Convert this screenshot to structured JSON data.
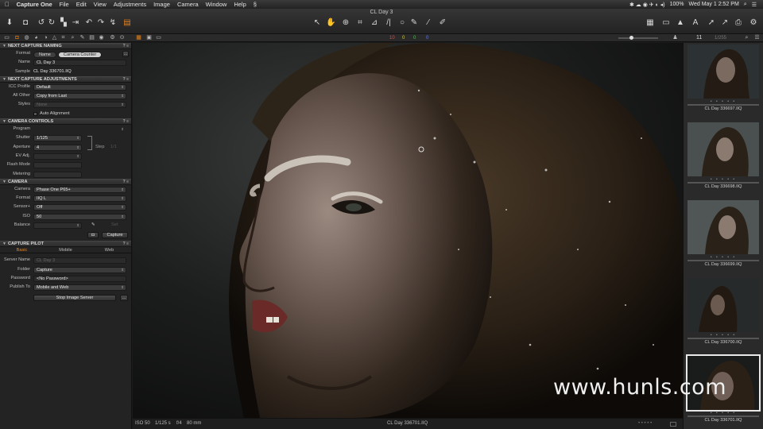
{
  "menubar": {
    "apple_icon": "apple-icon",
    "app": "Capture One",
    "items": [
      "File",
      "Edit",
      "View",
      "Adjustments",
      "Image",
      "Camera",
      "Window",
      "Help"
    ],
    "battery": "100%",
    "clock": "Wed May 1  2:52 PM"
  },
  "window": {
    "title": "CL Day 3"
  },
  "tool_numbers": {
    "a": "10",
    "b": "0",
    "c": "0",
    "d": "0"
  },
  "browser_header": {
    "count": "11",
    "index": "1/255"
  },
  "next_capture_naming": {
    "header": "NEXT CAPTURE NAMING",
    "format_label": "Format",
    "format_options": [
      "Name",
      "Camera Counter"
    ],
    "name_label": "Name",
    "name_value": "CL Day 3",
    "sample_label": "Sample",
    "sample_value": "CL Day 336701.IIQ"
  },
  "next_capture_adjustments": {
    "header": "NEXT CAPTURE ADJUSTMENTS",
    "icc_label": "ICC Profile",
    "icc_value": "Default",
    "other_label": "All Other",
    "other_value": "Copy from Last",
    "styles_label": "Styles",
    "styles_value": "None",
    "auto_alignment": "Auto Alignment"
  },
  "camera_controls": {
    "header": "CAMERA CONTROLS",
    "program_label": "Program",
    "shutter_label": "Shutter",
    "shutter_value": "1/125",
    "aperture_label": "Aperture",
    "aperture_value": "4",
    "ev_label": "EV Adj.",
    "flash_label": "Flash Mode",
    "metering_label": "Metering",
    "step_label": "Step",
    "step_value": "1/1"
  },
  "camera": {
    "header": "CAMERA",
    "camera_label": "Camera",
    "camera_value": "Phase One P65+",
    "format_label": "Format",
    "format_value": "IIQ L",
    "sensor_label": "Sensor+",
    "sensor_value": "Off",
    "iso_label": "ISO",
    "iso_value": "50",
    "balance_label": "Balance",
    "set_label": "Set",
    "capture_button": "Capture"
  },
  "capture_pilot": {
    "header": "CAPTURE PILOT",
    "tabs": [
      "Basic",
      "Mobile",
      "Web"
    ],
    "server_label": "Server Name",
    "server_value": "CL Day 3",
    "folder_label": "Folder",
    "folder_value": "Capture",
    "password_label": "Password",
    "password_value": "<No Password>",
    "publish_label": "Publish To",
    "publish_value": "Mobile and Web",
    "stop_button": "Stop Image Server"
  },
  "status": {
    "iso": "ISO 50",
    "shutter": "1/125 s",
    "aperture": "f/4",
    "focal": "80 mm",
    "filename": "CL Day 336701.IIQ"
  },
  "browser": {
    "thumbs": [
      {
        "caption": "CL Day 336697.IIQ"
      },
      {
        "caption": "CL Day 336698.IIQ"
      },
      {
        "caption": "CL Day 336699.IIQ"
      },
      {
        "caption": "CL Day 336700.IIQ"
      },
      {
        "caption": "CL Day 336701.IIQ",
        "selected": true
      }
    ]
  },
  "watermark": "www.hunls.com",
  "colors": {
    "accent": "#e6821e",
    "panel": "#232323",
    "viewer_bg": "#0f0f0f"
  }
}
